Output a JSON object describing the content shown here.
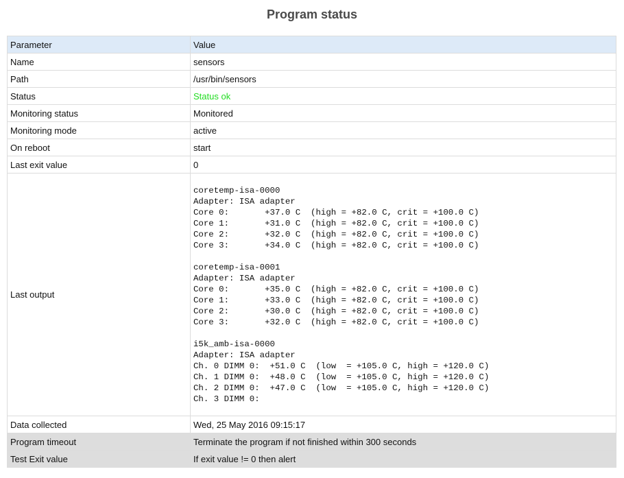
{
  "title": "Program status",
  "header": {
    "param": "Parameter",
    "value": "Value"
  },
  "rows": [
    {
      "label": "Name",
      "value": "sensors"
    },
    {
      "label": "Path",
      "value": "/usr/bin/sensors"
    },
    {
      "label": "Status",
      "value": "Status ok"
    },
    {
      "label": "Monitoring status",
      "value": "Monitored"
    },
    {
      "label": "Monitoring mode",
      "value": "active"
    },
    {
      "label": "On reboot",
      "value": "start"
    },
    {
      "label": "Last exit value",
      "value": "0"
    },
    {
      "label": "Last output",
      "value": "coretemp-isa-0000\nAdapter: ISA adapter\nCore 0:       +37.0 C  (high = +82.0 C, crit = +100.0 C)\nCore 1:       +31.0 C  (high = +82.0 C, crit = +100.0 C)\nCore 2:       +32.0 C  (high = +82.0 C, crit = +100.0 C)\nCore 3:       +34.0 C  (high = +82.0 C, crit = +100.0 C)\n\ncoretemp-isa-0001\nAdapter: ISA adapter\nCore 0:       +35.0 C  (high = +82.0 C, crit = +100.0 C)\nCore 1:       +33.0 C  (high = +82.0 C, crit = +100.0 C)\nCore 2:       +30.0 C  (high = +82.0 C, crit = +100.0 C)\nCore 3:       +32.0 C  (high = +82.0 C, crit = +100.0 C)\n\ni5k_amb-isa-0000\nAdapter: ISA adapter\nCh. 0 DIMM 0:  +51.0 C  (low  = +105.0 C, high = +120.0 C)\nCh. 1 DIMM 0:  +48.0 C  (low  = +105.0 C, high = +120.0 C)\nCh. 2 DIMM 0:  +47.0 C  (low  = +105.0 C, high = +120.0 C)\nCh. 3 DIMM 0:"
    },
    {
      "label": "Data collected",
      "value": "Wed, 25 May 2016 09:15:17"
    },
    {
      "label": "Program timeout",
      "value": "Terminate the program if not finished within 300 seconds"
    },
    {
      "label": "Test Exit value",
      "value": "If exit value != 0 then alert"
    }
  ],
  "colors": {
    "header_bg": "#ddeaf8",
    "status_ok": "#22dd22",
    "test_row_bg": "#dddddd"
  }
}
